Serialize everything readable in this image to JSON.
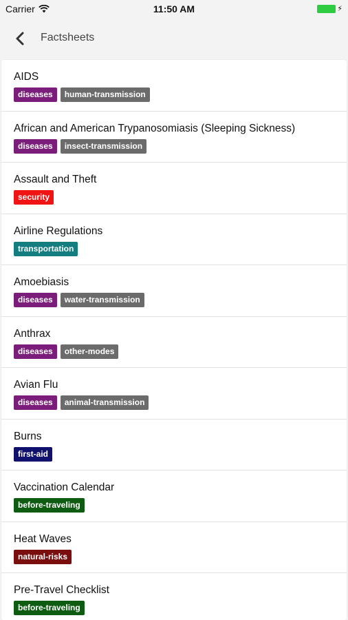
{
  "status": {
    "carrier": "Carrier",
    "time": "11:50 AM"
  },
  "nav": {
    "title": "Factsheets"
  },
  "tag_colors": {
    "diseases": "#7b1e7b",
    "human-transmission": "#6b6b6b",
    "insect-transmission": "#6b6b6b",
    "water-transmission": "#6b6b6b",
    "other-modes": "#6b6b6b",
    "animal-transmission": "#6b6b6b",
    "security": "#f01414",
    "transportation": "#137d80",
    "first-aid": "#10106e",
    "before-traveling": "#0d5c12",
    "natural-risks": "#7a0d0d"
  },
  "items": [
    {
      "title": "AIDS",
      "tags": [
        "diseases",
        "human-transmission"
      ]
    },
    {
      "title": "African and American Trypanosomiasis (Sleeping Sickness)",
      "tags": [
        "diseases",
        "insect-transmission"
      ]
    },
    {
      "title": "Assault and Theft",
      "tags": [
        "security"
      ]
    },
    {
      "title": "Airline Regulations",
      "tags": [
        "transportation"
      ]
    },
    {
      "title": "Amoebiasis",
      "tags": [
        "diseases",
        "water-transmission"
      ]
    },
    {
      "title": "Anthrax",
      "tags": [
        "diseases",
        "other-modes"
      ]
    },
    {
      "title": "Avian Flu",
      "tags": [
        "diseases",
        "animal-transmission"
      ]
    },
    {
      "title": "Burns",
      "tags": [
        "first-aid"
      ]
    },
    {
      "title": "Vaccination Calendar",
      "tags": [
        "before-traveling"
      ]
    },
    {
      "title": "Heat Waves",
      "tags": [
        "natural-risks"
      ]
    },
    {
      "title": "Pre-Travel Checklist",
      "tags": [
        "before-traveling"
      ]
    }
  ]
}
